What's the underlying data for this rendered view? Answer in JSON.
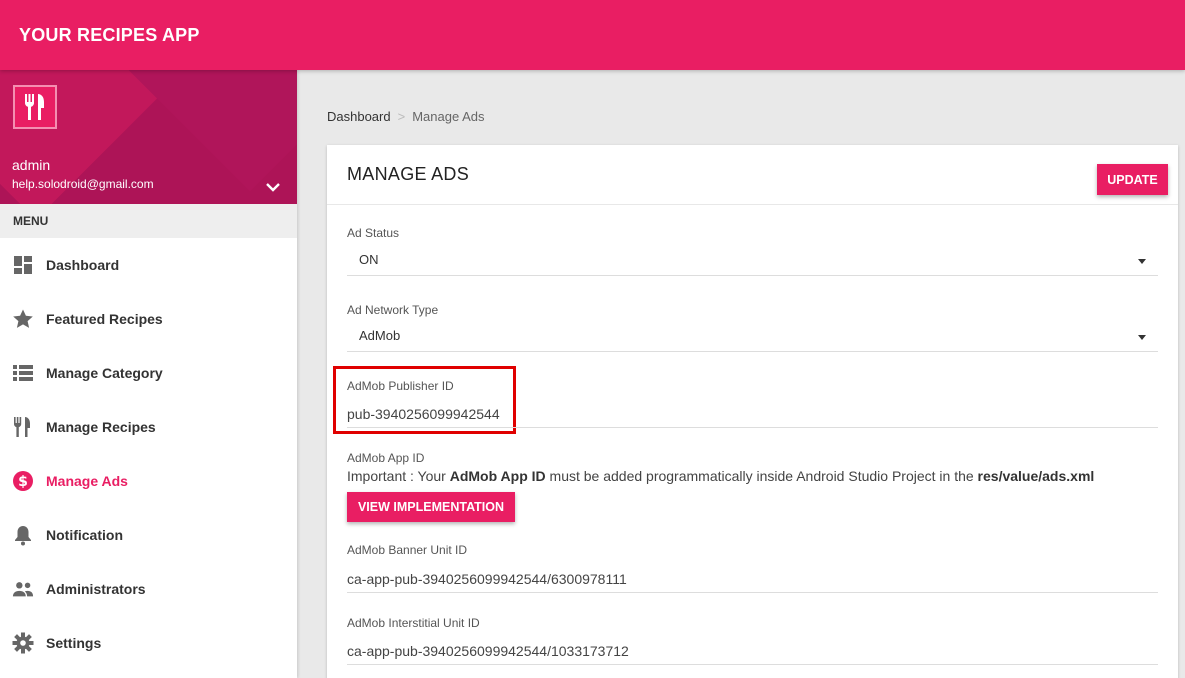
{
  "app": {
    "title": "YOUR RECIPES APP"
  },
  "user": {
    "name": "admin",
    "email": "help.solodroid@gmail.com"
  },
  "menu": {
    "header": "MENU",
    "items": [
      {
        "label": "Dashboard",
        "icon": "dashboard-icon"
      },
      {
        "label": "Featured Recipes",
        "icon": "star-icon"
      },
      {
        "label": "Manage Category",
        "icon": "list-icon"
      },
      {
        "label": "Manage Recipes",
        "icon": "utensils-icon"
      },
      {
        "label": "Manage Ads",
        "icon": "dollar-icon",
        "active": true
      },
      {
        "label": "Notification",
        "icon": "bell-icon"
      },
      {
        "label": "Administrators",
        "icon": "people-icon"
      },
      {
        "label": "Settings",
        "icon": "gear-icon"
      }
    ]
  },
  "breadcrumb": {
    "home": "Dashboard",
    "separator": ">",
    "current": "Manage Ads"
  },
  "card": {
    "title": "MANAGE ADS",
    "update_label": "UPDATE",
    "ad_status": {
      "label": "Ad Status",
      "value": "ON"
    },
    "ad_network": {
      "label": "Ad Network Type",
      "value": "AdMob"
    },
    "publisher_id": {
      "label": "AdMob Publisher ID",
      "value": "pub-3940256099942544"
    },
    "app_id": {
      "label": "AdMob App ID",
      "note_prefix": "Important : Your ",
      "note_bold1": "AdMob App ID",
      "note_mid": " must be added programmatically inside Android Studio Project in the ",
      "note_bold2": "res/value/ads.xml",
      "button_label": "VIEW IMPLEMENTATION"
    },
    "banner_id": {
      "label": "AdMob Banner Unit ID",
      "value": "ca-app-pub-3940256099942544/6300978111"
    },
    "interstitial_id": {
      "label": "AdMob Interstitial Unit ID",
      "value": "ca-app-pub-3940256099942544/1033173712"
    }
  },
  "colors": {
    "primary": "#e91e63",
    "sidebar_header": "#ad1457",
    "highlight": "#e00000"
  }
}
